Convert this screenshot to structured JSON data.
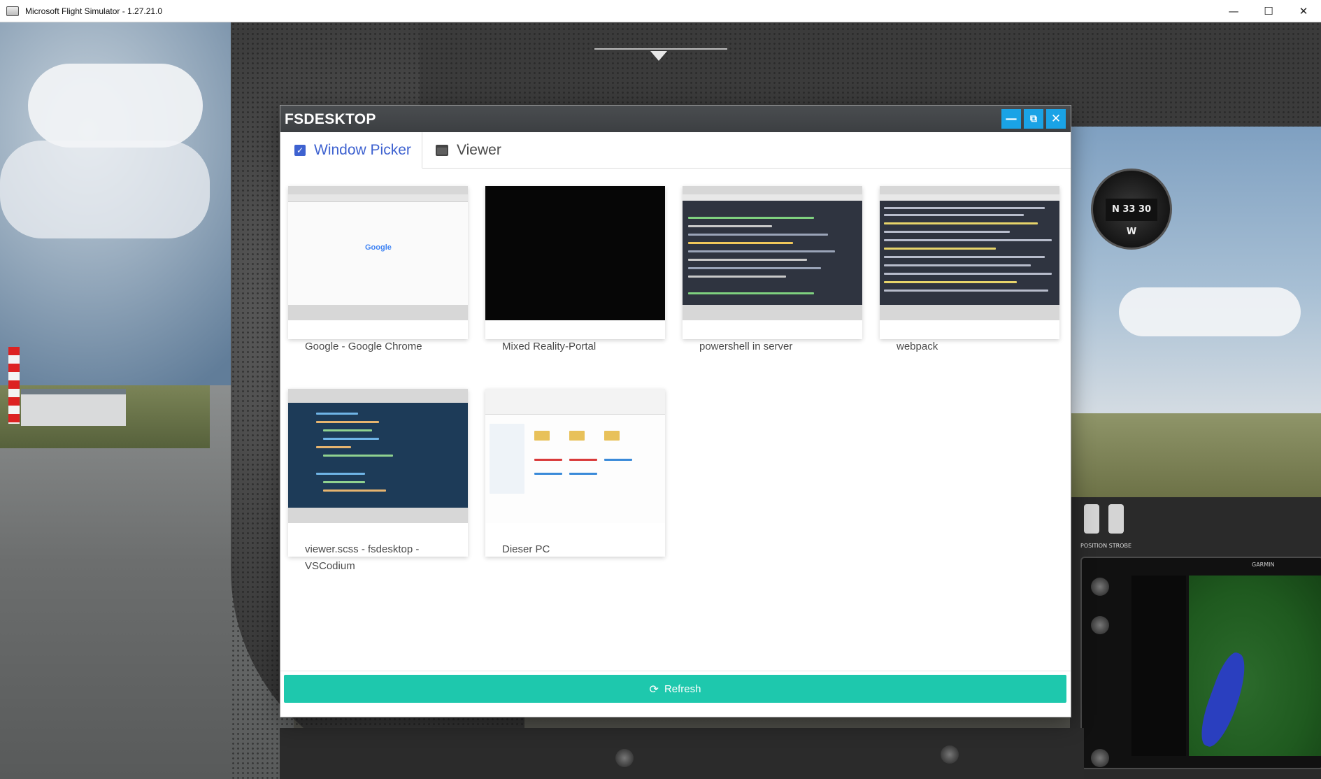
{
  "os_window": {
    "title": "Microsoft Flight Simulator - 1.27.21.0",
    "controls": {
      "minimize": "—",
      "maximize": "☐",
      "close": "✕"
    }
  },
  "cockpit": {
    "compass_reading": "N 33 30 W",
    "switch_labels": "POSITION  STROBE",
    "avionics_brand": "GARMIN"
  },
  "dialog": {
    "title": "FSDESKTOP",
    "buttons": {
      "minimize": "—",
      "popout": "⧉",
      "close": "✕"
    },
    "tabs": [
      {
        "label": "Window Picker",
        "icon": "checkbox-icon",
        "active": true
      },
      {
        "label": "Viewer",
        "icon": "window-icon",
        "active": false
      }
    ],
    "windows": [
      {
        "label": "Google - Google Chrome",
        "thumbnail": "chrome",
        "thumb_text": "Google"
      },
      {
        "label": "Mixed Reality-Portal",
        "thumbnail": "black-screen"
      },
      {
        "label": "powershell in server",
        "thumbnail": "terminal"
      },
      {
        "label": "webpack",
        "thumbnail": "terminal"
      },
      {
        "label": "viewer.scss - fsdesktop - VSCodium",
        "thumbnail": "code-editor"
      },
      {
        "label": "Dieser PC",
        "thumbnail": "file-explorer"
      }
    ],
    "refresh_label": "Refresh",
    "accent_color": "#1ec8ad",
    "tab_active_color": "#3e62d0",
    "titlebar_button_color": "#1aa3e6"
  }
}
